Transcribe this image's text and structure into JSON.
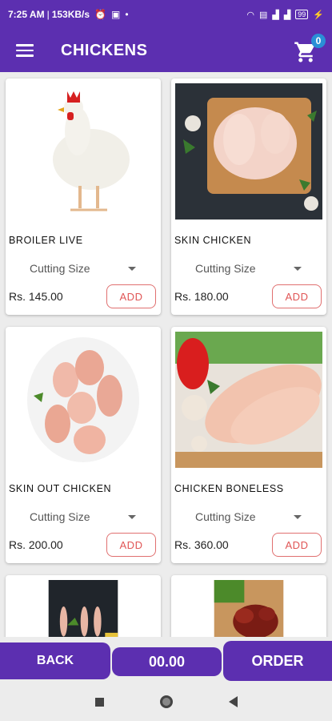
{
  "status": {
    "time": "7:25 AM",
    "speed": "153KB/s",
    "battery": "99"
  },
  "header": {
    "title": "CHICKENS",
    "cart_count": "0"
  },
  "products": [
    {
      "name": "BROILER LIVE",
      "cutting": "Cutting Size",
      "price": "Rs. 145.00",
      "add": "ADD"
    },
    {
      "name": "SKIN CHICKEN",
      "cutting": "Cutting Size",
      "price": "Rs. 180.00",
      "add": "ADD"
    },
    {
      "name": "SKIN OUT CHICKEN",
      "cutting": "Cutting Size",
      "price": "Rs. 200.00",
      "add": "ADD"
    },
    {
      "name": "CHICKEN BONELESS",
      "cutting": "Cutting Size",
      "price": "Rs. 360.00",
      "add": "ADD"
    }
  ],
  "footer": {
    "back": "BACK",
    "total": "00.00",
    "order": "ORDER"
  },
  "colors": {
    "primary": "#5c2fb0",
    "accent": "#e05555",
    "badge": "#2a8fd6"
  }
}
